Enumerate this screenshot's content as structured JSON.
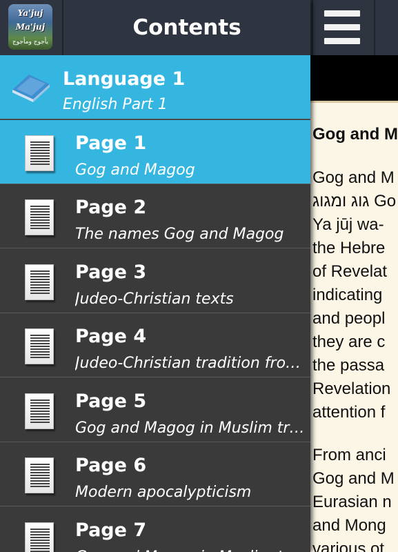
{
  "header": {
    "title": "Contents"
  },
  "app_icon": {
    "line1": "Ya'juj",
    "line2": "Ma'juj",
    "line3": "يأجوج ومأجوج"
  },
  "drawer": {
    "group": {
      "title": "Language 1",
      "subtitle": "English Part 1"
    },
    "items": [
      {
        "title": "Page 1",
        "subtitle": "Gog and Magog",
        "active": true
      },
      {
        "title": "Page 2",
        "subtitle": "The names Gog and Magog",
        "active": false
      },
      {
        "title": "Page 3",
        "subtitle": "Judeo-Christian texts",
        "active": false
      },
      {
        "title": "Page 4",
        "subtitle": "Judeo-Christian tradition from...",
        "active": false
      },
      {
        "title": "Page 5",
        "subtitle": "Gog and Magog in Muslim trad...",
        "active": false
      },
      {
        "title": "Page 6",
        "subtitle": "Modern apocalypticism",
        "active": false
      },
      {
        "title": "Page 7",
        "subtitle": "Gog and Magog in Muslim tra",
        "active": false
      }
    ]
  },
  "article": {
    "title": "Gog and M",
    "lines": [
      "Gog and M",
      "גוג ומגוג Go",
      "Ya jūj wa-",
      "the Hebre",
      "of Revelat",
      "indicating",
      "and peopl",
      "they are c",
      "the passa",
      "Revelation",
      "attention f"
    ],
    "lines2": [
      "From anci",
      "Gog and M",
      "Eurasian n",
      "and Mong",
      "various ot"
    ]
  },
  "colors": {
    "accent": "#35b6e1",
    "drawer_bg": "#3a3a3a",
    "topbar": "#2f3540",
    "article_bg": "#fbf6e6"
  },
  "icons": {
    "menu": "hamburger-menu-icon",
    "group": "book-icon",
    "item": "document-icon"
  }
}
